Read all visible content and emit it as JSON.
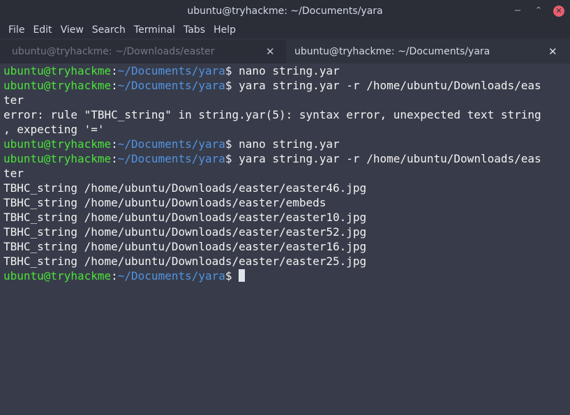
{
  "window": {
    "title": "ubuntu@tryhackme: ~/Documents/yara",
    "minimize_glyph": "−",
    "maximize_glyph": "⌃",
    "close_glyph": "✕"
  },
  "menu": [
    "File",
    "Edit",
    "View",
    "Search",
    "Terminal",
    "Tabs",
    "Help"
  ],
  "tabs": [
    {
      "label": "ubuntu@tryhackme: ~/Downloads/easter",
      "active": false,
      "close_glyph": "✕"
    },
    {
      "label": "ubuntu@tryhackme: ~/Documents/yara",
      "active": true,
      "close_glyph": "✕"
    }
  ],
  "terminal": {
    "prompt_user": "ubuntu@tryhackme",
    "prompt_sep": ":",
    "prompt_path": "~/Documents/yara",
    "prompt_suffix": "$ ",
    "lines": [
      {
        "kind": "cmd",
        "text": "nano string.yar"
      },
      {
        "kind": "cmd",
        "text": "yara string.yar -r /home/ubuntu/Downloads/eas"
      },
      {
        "kind": "out",
        "text": "ter"
      },
      {
        "kind": "out",
        "text": "error: rule \"TBHC_string\" in string.yar(5): syntax error, unexpected text string"
      },
      {
        "kind": "out",
        "text": ", expecting '='"
      },
      {
        "kind": "cmd",
        "text": "nano string.yar"
      },
      {
        "kind": "cmd",
        "text": "yara string.yar -r /home/ubuntu/Downloads/eas"
      },
      {
        "kind": "out",
        "text": "ter"
      },
      {
        "kind": "out",
        "text": "TBHC_string /home/ubuntu/Downloads/easter/easter46.jpg"
      },
      {
        "kind": "out",
        "text": "TBHC_string /home/ubuntu/Downloads/easter/embeds"
      },
      {
        "kind": "out",
        "text": "TBHC_string /home/ubuntu/Downloads/easter/easter10.jpg"
      },
      {
        "kind": "out",
        "text": "TBHC_string /home/ubuntu/Downloads/easter/easter52.jpg"
      },
      {
        "kind": "out",
        "text": "TBHC_string /home/ubuntu/Downloads/easter/easter16.jpg"
      },
      {
        "kind": "out",
        "text": "TBHC_string /home/ubuntu/Downloads/easter/easter25.jpg"
      },
      {
        "kind": "prompt",
        "text": ""
      }
    ]
  }
}
